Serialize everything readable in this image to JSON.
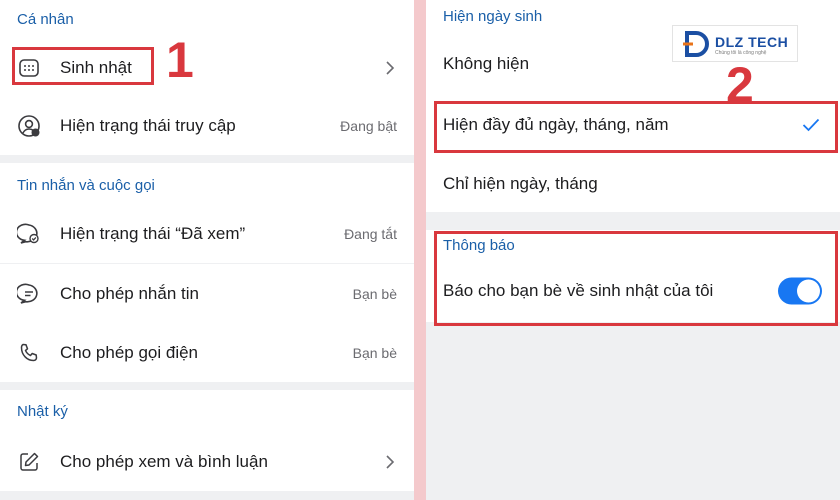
{
  "left": {
    "personal": {
      "header": "Cá nhân",
      "birthday_label": "Sinh nhật",
      "access_status_label": "Hiện trạng thái truy cập",
      "access_status_value": "Đang bật"
    },
    "messages": {
      "header": "Tin nhắn và cuộc gọi",
      "seen_status_label": "Hiện trạng thái “Đã xem”",
      "seen_status_value": "Đang tắt",
      "allow_messages_label": "Cho phép nhắn tin",
      "allow_messages_value": "Bạn bè",
      "allow_calls_label": "Cho phép gọi điện",
      "allow_calls_value": "Bạn bè"
    },
    "diary": {
      "header": "Nhật ký",
      "view_comment_label": "Cho phép xem và bình luận"
    },
    "step_number": "1"
  },
  "right": {
    "birthday_display": {
      "header": "Hiện ngày sinh",
      "options": [
        "Không hiện",
        "Hiện đầy đủ ngày, tháng, năm",
        "Chỉ hiện ngày, tháng"
      ],
      "selected_index": 1
    },
    "notifications": {
      "header": "Thông báo",
      "notify_friends_label": "Báo cho bạn bè về sinh nhật của tôi",
      "notify_friends_on": true
    },
    "step_number": "2"
  },
  "logo": {
    "brand": "DLZ TECH",
    "tagline": "Chúng tôi là công nghệ"
  },
  "colors": {
    "accent": "#1877f2",
    "section_header": "#1a5fa8",
    "highlight": "#d9383e"
  },
  "icons": [
    "calendar-icon",
    "user-status-icon",
    "seen-chat-icon",
    "message-icon",
    "phone-icon",
    "edit-icon",
    "chevron-right-icon",
    "checkmark-icon"
  ]
}
